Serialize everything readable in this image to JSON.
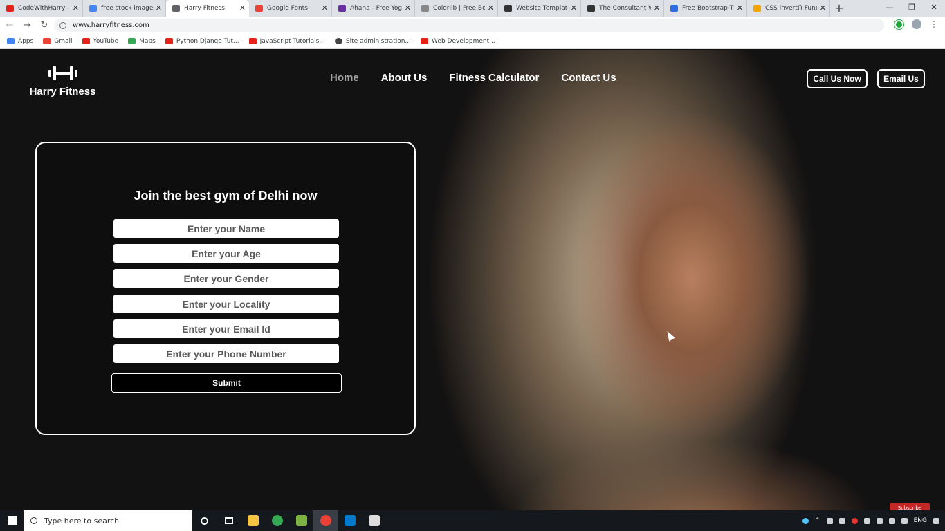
{
  "browser": {
    "tabs": [
      {
        "label": "CodeWithHarry - Yo",
        "favicon_color": "#e62117"
      },
      {
        "label": "free stock images -",
        "favicon_color": "#4285f4"
      },
      {
        "label": "Harry Fitness",
        "favicon_color": "#5f6368",
        "active": true
      },
      {
        "label": "Google Fonts",
        "favicon_color": "#ea4335"
      },
      {
        "label": "Ahana - Free Yoga",
        "favicon_color": "#6b2fa5"
      },
      {
        "label": "Colorlib | Free Boot",
        "favicon_color": "#888888"
      },
      {
        "label": "Website Templates",
        "favicon_color": "#333333"
      },
      {
        "label": "The Consultant We",
        "favicon_color": "#333333"
      },
      {
        "label": "Free Bootstrap The",
        "favicon_color": "#2a6ee5"
      },
      {
        "label": "CSS invert() Functio",
        "favicon_color": "#f0a500"
      }
    ],
    "new_tab": "+",
    "window_controls": {
      "minimize": "—",
      "restore": "❐",
      "close": "✕"
    },
    "url": "www.harryfitness.com",
    "bookmarks": [
      {
        "label": "Apps",
        "color": "#4285f4"
      },
      {
        "label": "Gmail",
        "color": "#ea4335"
      },
      {
        "label": "YouTube",
        "color": "#e62117"
      },
      {
        "label": "Maps",
        "color": "#34a853"
      },
      {
        "label": "Python Django Tut...",
        "color": "#e62117"
      },
      {
        "label": "JavaScript Tutorials...",
        "color": "#e62117"
      },
      {
        "label": "Site administration...",
        "color": "#444444"
      },
      {
        "label": "Web Development...",
        "color": "#e62117"
      }
    ]
  },
  "site": {
    "brand": "Harry Fitness",
    "nav": [
      {
        "label": "Home",
        "active": true
      },
      {
        "label": "About Us"
      },
      {
        "label": "Fitness Calculator"
      },
      {
        "label": "Contact Us"
      }
    ],
    "cta": {
      "call": "Call Us Now",
      "email": "Email Us"
    },
    "form": {
      "heading": "Join the best gym of Delhi now",
      "fields": [
        "Enter your Name",
        "Enter your Age",
        "Enter your Gender",
        "Enter your Locality",
        "Enter your Email Id",
        "Enter your Phone Number"
      ],
      "submit": "Submit"
    },
    "badge": "Subscribe"
  },
  "taskbar": {
    "search_placeholder": "Type here to search",
    "pinned": [
      {
        "name": "file-explorer",
        "color": "#f6c343"
      },
      {
        "name": "chrome",
        "color": "#34a853"
      },
      {
        "name": "notepad",
        "color": "#7cb342"
      },
      {
        "name": "chrome-alt",
        "color": "#ea4335"
      },
      {
        "name": "vscode",
        "color": "#007acc"
      },
      {
        "name": "photos",
        "color": "#dddddd"
      }
    ],
    "lang": "ENG"
  }
}
